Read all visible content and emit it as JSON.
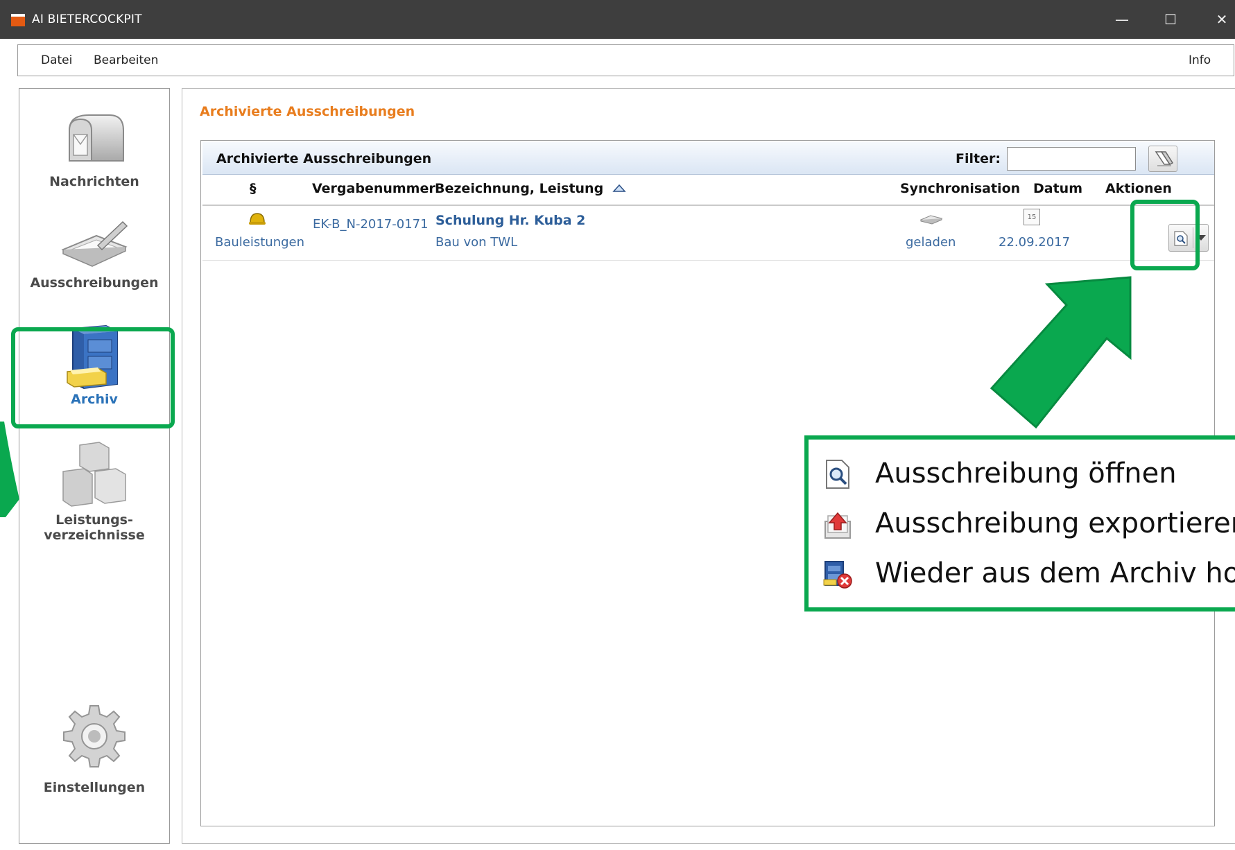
{
  "window": {
    "title": "AI BIETERCOCKPIT",
    "minimize": "—",
    "maximize": "☐",
    "close": "✕"
  },
  "menu": {
    "datei": "Datei",
    "bearbeiten": "Bearbeiten",
    "info": "Info"
  },
  "sidebar": {
    "items": [
      {
        "label": "Nachrichten",
        "icon": "mailbox-icon"
      },
      {
        "label": "Ausschreibungen",
        "icon": "tablet-pen-icon"
      },
      {
        "label": "Archiv",
        "icon": "filing-cabinet-icon",
        "active": true
      },
      {
        "label_line1": "Leistungs-",
        "label_line2": "verzeichnisse",
        "icon": "cubes-icon"
      },
      {
        "label": "Einstellungen",
        "icon": "gear-icon"
      }
    ]
  },
  "main": {
    "page_title": "Archivierte Ausschreibungen",
    "panel_title": "Archivierte Ausschreibungen",
    "filter_label": "Filter:",
    "filter_value": "",
    "columns": {
      "paragraph": "§",
      "vergabenummer": "Vergabenummer",
      "bezeichnung": "Bezeichnung, Leistung",
      "synchronisation": "Synchronisation",
      "datum": "Datum",
      "aktionen": "Aktionen"
    },
    "rows": [
      {
        "category": "Bauleistungen",
        "vergabenummer": "EK-B_N-2017-0171",
        "title": "Schulung Hr. Kuba 2",
        "subtitle": "Bau von TWL",
        "sync": "geladen",
        "date_icon_day": "15",
        "datum": "22.09.2017"
      }
    ]
  },
  "popup_menu": {
    "items": [
      {
        "label": "Ausschreibung öffnen",
        "icon": "document-magnifier-icon"
      },
      {
        "label": "Ausschreibung exportieren",
        "icon": "export-tray-icon"
      },
      {
        "label": "Wieder aus dem Archiv hole",
        "icon": "restore-from-archive-icon"
      }
    ]
  },
  "colors": {
    "accent_orange": "#e87d1e",
    "link_blue": "#3b6aa0",
    "highlight_green": "#0aa84f"
  }
}
